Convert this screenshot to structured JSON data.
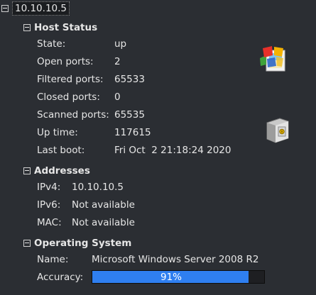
{
  "root": {
    "label": "10.10.10.5"
  },
  "host_status": {
    "title": "Host Status",
    "rows": [
      {
        "key": "State:",
        "value": "up"
      },
      {
        "key": "Open ports:",
        "value": "2"
      },
      {
        "key": "Filtered ports:",
        "value": "65533"
      },
      {
        "key": "Closed ports:",
        "value": "0"
      },
      {
        "key": "Scanned ports:",
        "value": "65535"
      },
      {
        "key": "Up time:",
        "value": "117615"
      },
      {
        "key": "Last boot:",
        "value": "Fri Oct  2 21:18:24 2020"
      }
    ]
  },
  "addresses": {
    "title": "Addresses",
    "rows": [
      {
        "key": "IPv4:",
        "value": "10.10.10.5"
      },
      {
        "key": "IPv6:",
        "value": "Not available"
      },
      {
        "key": "MAC:",
        "value": "Not available"
      }
    ]
  },
  "os": {
    "title": "Operating System",
    "name_key": "Name:",
    "name_value": "Microsoft Windows Server 2008 R2",
    "accuracy_key": "Accuracy:",
    "accuracy_text": "91%",
    "accuracy_value": 0.91,
    "accent_color": "#2f7ff0"
  },
  "icons": {
    "os_icon": "windows-os-icon",
    "security_icon": "safe-icon"
  }
}
